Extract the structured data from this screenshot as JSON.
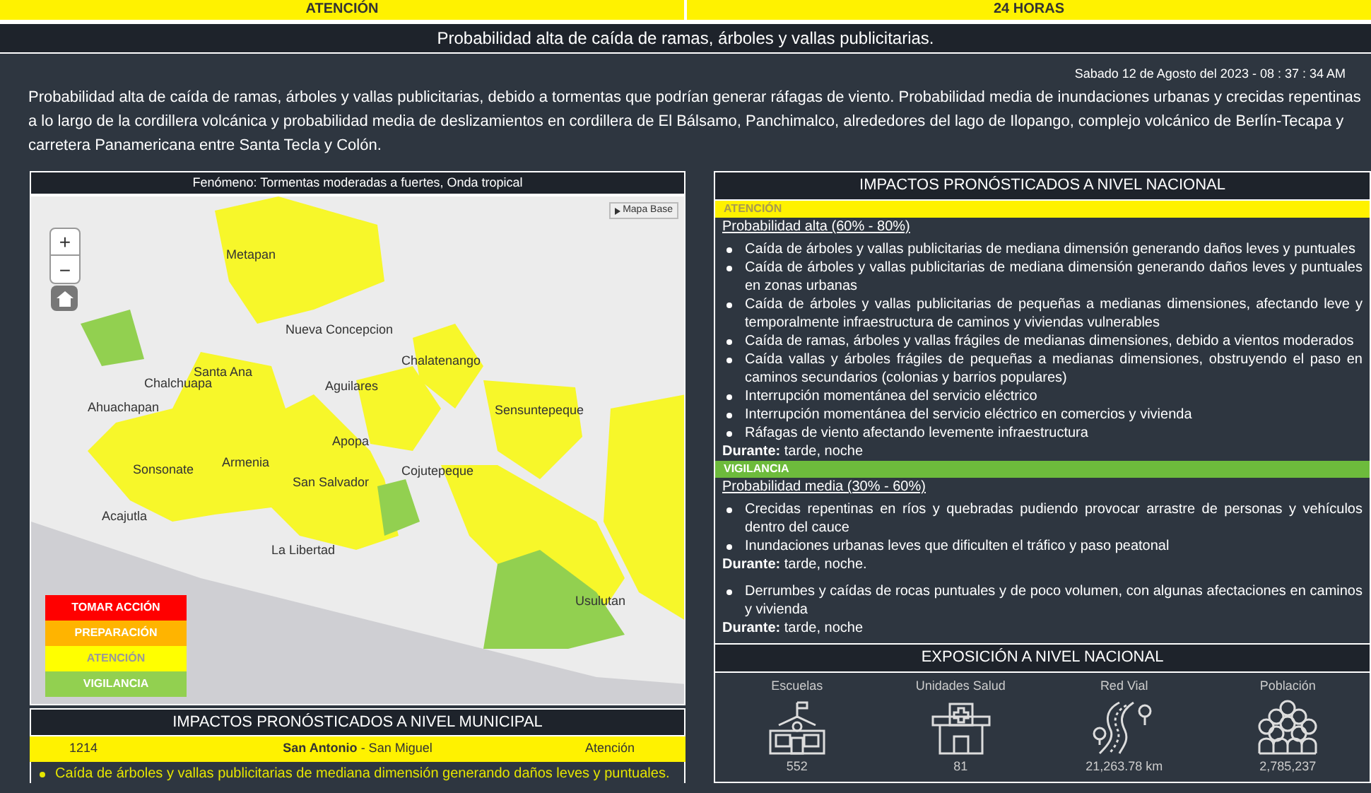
{
  "top_bar": [
    {
      "label": "ATENCIÓN"
    },
    {
      "label": "24 HORAS"
    }
  ],
  "subtitle": "Probabilidad alta de caída de ramas, árboles y vallas publicitarias.",
  "timestamp": "Sabado 12 de Agosto del 2023 - 08 : 37 : 34 AM",
  "summary": "Probabilidad alta de caída de ramas, árboles y vallas publicitarias, debido a tormentas que podrían generar ráfagas de viento. Probabilidad media de inundaciones urbanas y crecidas repentinas a lo largo de la cordillera volcánica y probabilidad media de deslizamientos en cordillera de El Bálsamo, Panchimalco, alrededores del lago de Ilopango, complejo volcánico de Berlín-Tecapa y carretera Panamericana entre Santa Tecla y Colón.",
  "map": {
    "title": "Fenómeno: Tormentas moderadas a fuertes, Onda tropical",
    "base_button": "Mapa Base",
    "zoom_in": "+",
    "zoom_out": "−",
    "places": [
      "Metapan",
      "Nueva Concepcion",
      "Chalatenango",
      "Santa Ana",
      "Chalchuapa",
      "Ahuachapan",
      "Aguilares",
      "Sensuntepeque",
      "Apopa",
      "Armenia",
      "Sonsonate",
      "San Salvador",
      "Cojutepeque",
      "Acajutla",
      "La Libertad",
      "Usulutan"
    ],
    "legend": [
      {
        "label": "TOMAR ACCIÓN",
        "color": "#ff0000"
      },
      {
        "label": "PREPARACIÓN",
        "color": "#ffb400"
      },
      {
        "label": "ATENCIÓN",
        "color": "#ffff00"
      },
      {
        "label": "VIGILANCIA",
        "color": "#92d050"
      }
    ]
  },
  "municipal": {
    "title": "IMPACTOS PRONÓSTICADOS A NIVEL MUNICIPAL",
    "row": {
      "code": "1214",
      "name": "**San Antonio** - San Miguel",
      "level": "Atención",
      "color": "#fff200"
    },
    "items": [
      "Caída de árboles y vallas publicitarias de mediana dimensión generando daños leves y puntuales."
    ]
  },
  "national": {
    "title": "IMPACTOS PRONÓSTICADOS A NIVEL NACIONAL",
    "levels": [
      {
        "label": "ATENCIÓN",
        "color": "#fff200",
        "groups": [
          {
            "probability": "Probabilidad alta (60% - 80%)",
            "items": [
              "Caída de árboles y vallas publicitarias de mediana dimensión generando daños leves y puntuales",
              "Caída de árboles y vallas publicitarias de mediana dimensión generando daños leves y puntuales en zonas urbanas",
              "Caída de árboles y vallas publicitarias de pequeñas a medianas dimensiones, afectando leve y temporalmente infraestructura de caminos y viviendas vulnerables",
              "Caída de ramas, árboles y vallas frágiles de medianas dimensiones, debido a vientos moderados",
              "Caída vallas y árboles frágiles de pequeñas a medianas dimensiones, obstruyendo el paso en caminos secundarios (colonias y barrios populares)",
              "Interrupción momentánea del servicio eléctrico",
              "Interrupción momentánea del servicio eléctrico en comercios y vivienda",
              "Ráfagas de viento afectando levemente infraestructura"
            ],
            "during": "**Durante:** tarde, noche"
          }
        ]
      },
      {
        "label": "VIGILANCIA",
        "color": "#6dbb3c",
        "groups": [
          {
            "probability": "Probabilidad media (30% - 60%)",
            "items": [
              "Crecidas repentinas en ríos y quebradas pudiendo provocar arrastre de personas y vehículos dentro del cauce",
              "Inundaciones urbanas leves que dificulten el tráfico y paso peatonal"
            ],
            "during": "**Durante:** tarde, noche."
          },
          {
            "items": [
              "Derrumbes y caídas de rocas puntuales y de poco volumen, con algunas afectaciones en caminos y vivienda"
            ],
            "during": "**Durante:** tarde, noche"
          }
        ]
      }
    ]
  },
  "exposure": {
    "title": "EXPOSICIÓN A NIVEL NACIONAL",
    "stats": [
      {
        "kind": "school",
        "label": "Escuelas",
        "value": "552"
      },
      {
        "kind": "health",
        "label": "Unidades Salud",
        "value": "81"
      },
      {
        "kind": "road",
        "label": "Red Vial",
        "value": "21,263.78 km"
      },
      {
        "kind": "population",
        "label": "Población",
        "value": "2,785,237"
      }
    ]
  }
}
